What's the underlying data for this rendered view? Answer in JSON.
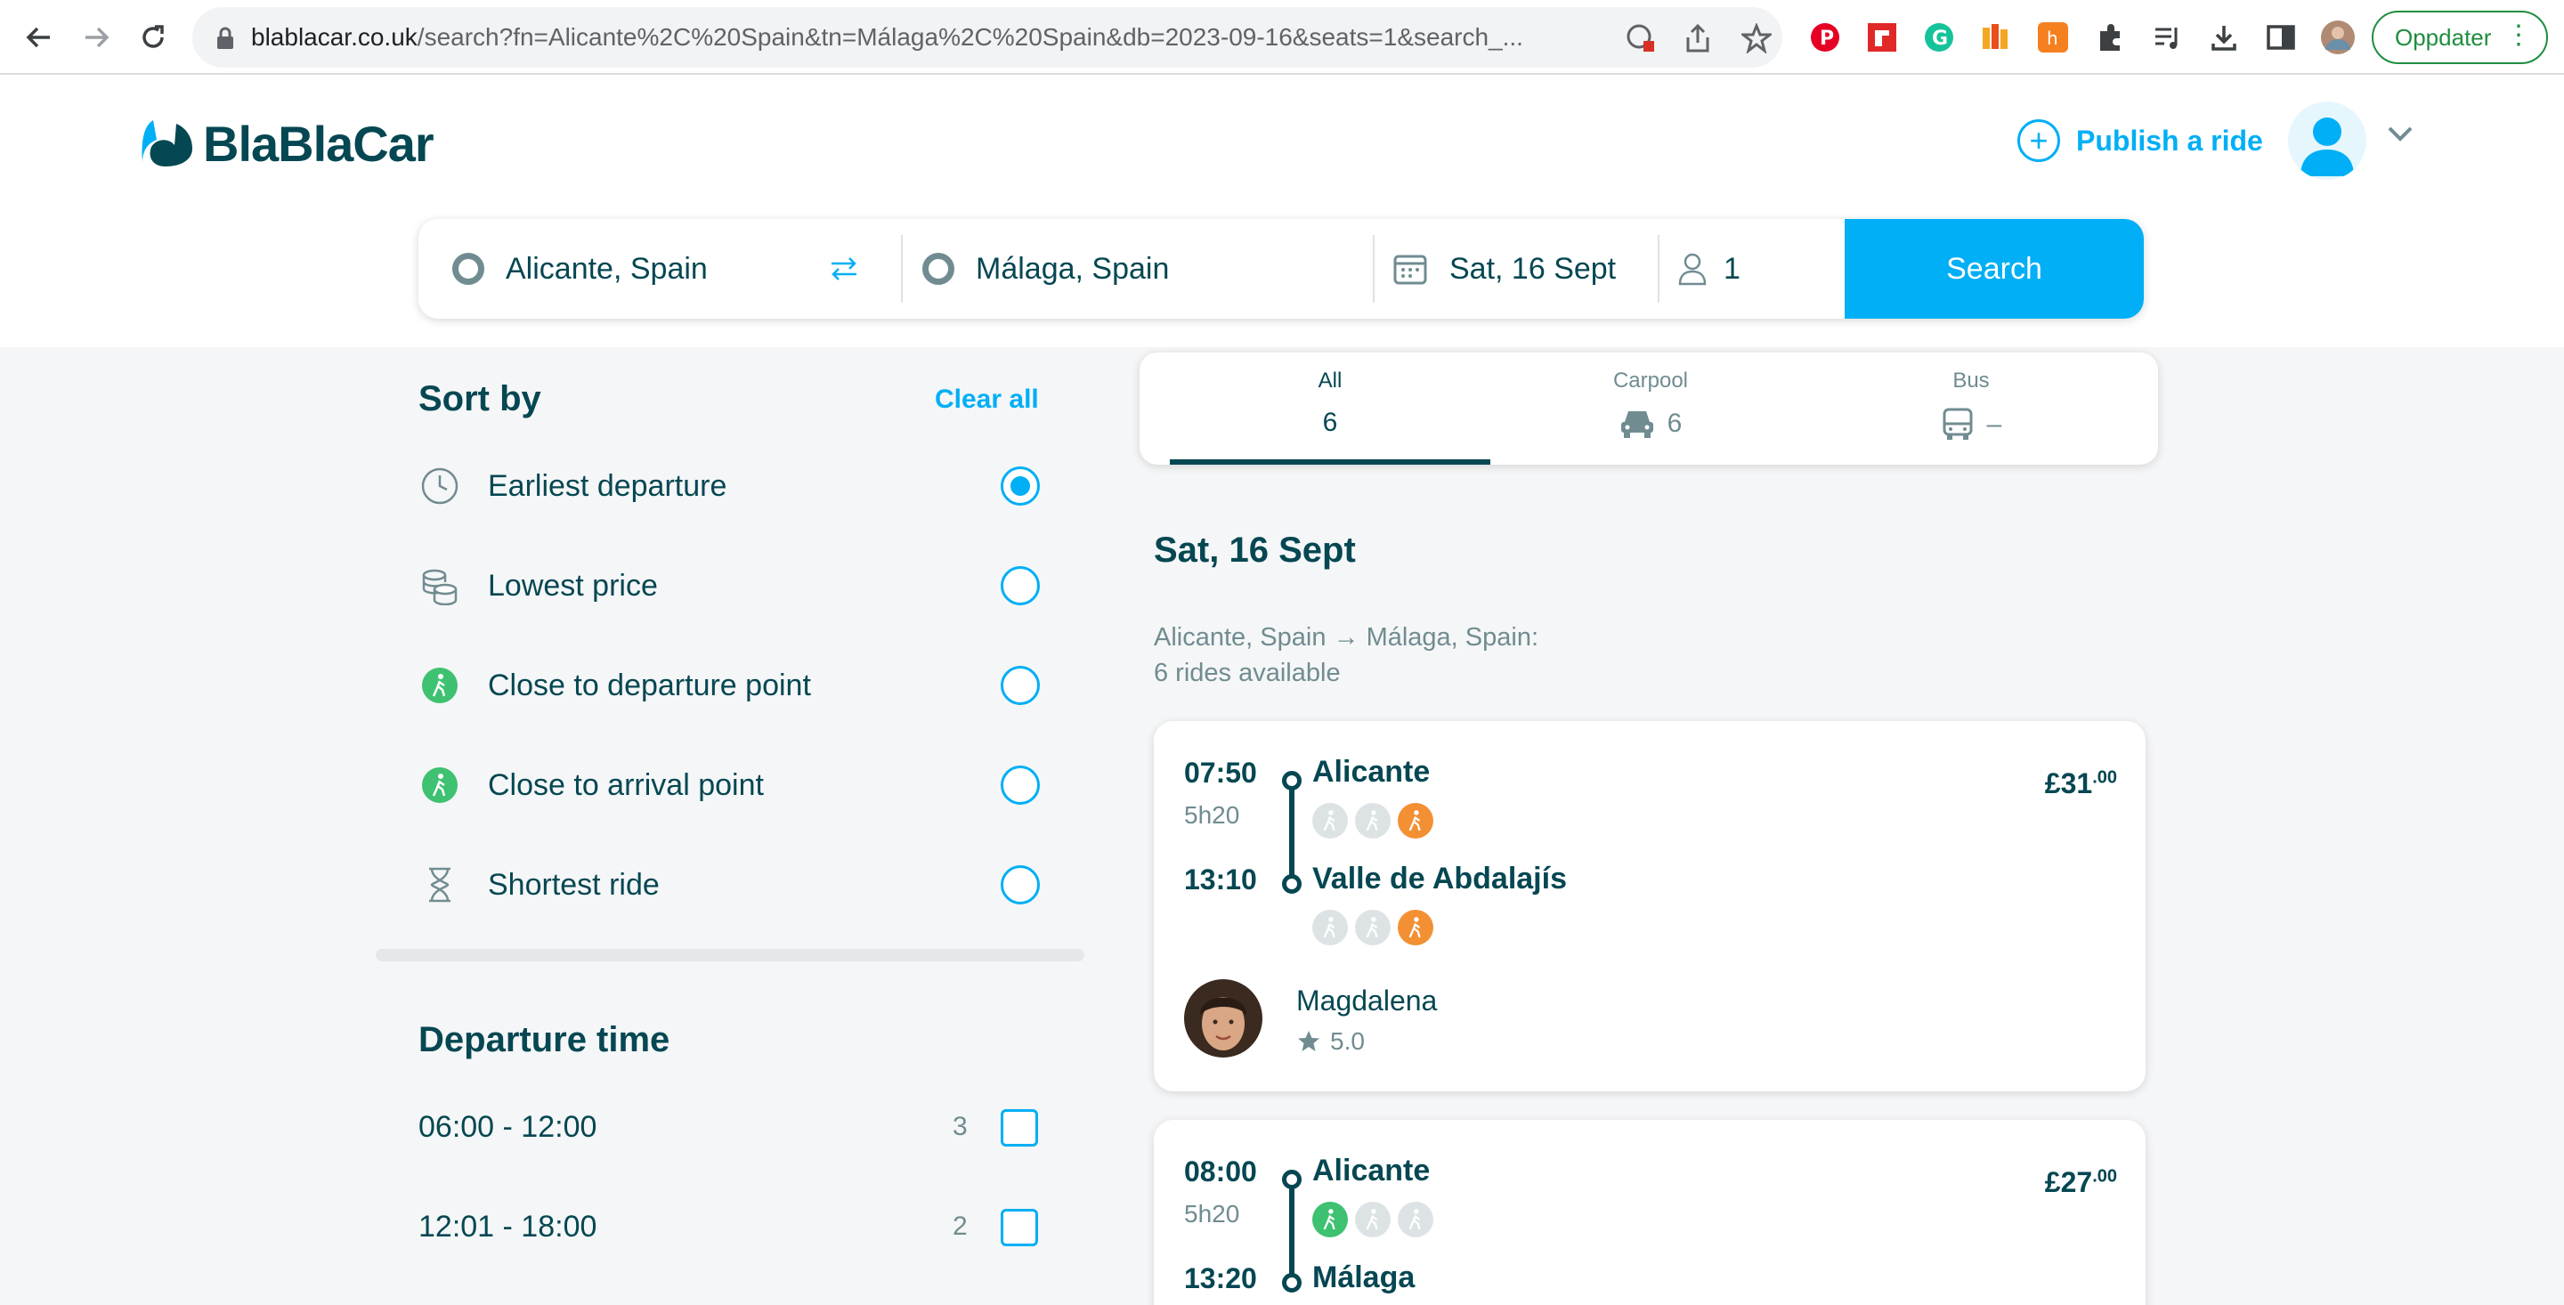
{
  "browser": {
    "url_host": "blablacar.co.uk",
    "url_path": "/search?fn=Alicante%2C%20Spain&tn=Málaga%2C%20Spain&db=2023-09-16&seats=1&search_...",
    "update_label": "Oppdater"
  },
  "header": {
    "logo_text": "BlaBlaCar",
    "publish_label": "Publish a ride"
  },
  "search": {
    "from": "Alicante, Spain",
    "to": "Málaga, Spain",
    "date": "Sat, 16 Sept",
    "seats": "1",
    "button_label": "Search"
  },
  "sort": {
    "title": "Sort by",
    "clear_label": "Clear all",
    "options": [
      {
        "label": "Earliest departure",
        "icon": "clock-icon",
        "selected": true
      },
      {
        "label": "Lowest price",
        "icon": "coins-icon",
        "selected": false
      },
      {
        "label": "Close to departure point",
        "icon": "walking-icon",
        "selected": false
      },
      {
        "label": "Close to arrival point",
        "icon": "walking-icon",
        "selected": false
      },
      {
        "label": "Shortest ride",
        "icon": "hourglass-icon",
        "selected": false
      }
    ]
  },
  "departure_time": {
    "title": "Departure time",
    "ranges": [
      {
        "label": "06:00 - 12:00",
        "count": "3"
      },
      {
        "label": "12:01 - 18:00",
        "count": "2"
      }
    ]
  },
  "tabs": [
    {
      "label": "All",
      "value": "6",
      "icon": "",
      "active": true
    },
    {
      "label": "Carpool",
      "value": "6",
      "icon": "car-icon",
      "active": false
    },
    {
      "label": "Bus",
      "value": "–",
      "icon": "bus-icon",
      "active": false
    }
  ],
  "results": {
    "day": "Sat, 16 Sept",
    "route_line": "Alicante, Spain → Málaga, Spain:",
    "count_line": "6 rides available",
    "rides": [
      {
        "depart_time": "07:50",
        "duration": "5h20",
        "arrive_time": "13:10",
        "from": "Alicante",
        "to": "Valle de Abdalajís",
        "price_main": "£31",
        "price_cents": ".00",
        "driver": "Magdalena",
        "rating": "5.0"
      },
      {
        "depart_time": "08:00",
        "duration": "5h20",
        "arrive_time": "13:20",
        "from": "Alicante",
        "to": "Málaga",
        "price_main": "£27",
        "price_cents": ".00"
      }
    ]
  },
  "colors": {
    "brand_blue": "#00aff5",
    "text_dark": "#054752",
    "text_muted": "#708c91",
    "walk_green": "#3ec171",
    "walk_orange": "#f39033"
  }
}
